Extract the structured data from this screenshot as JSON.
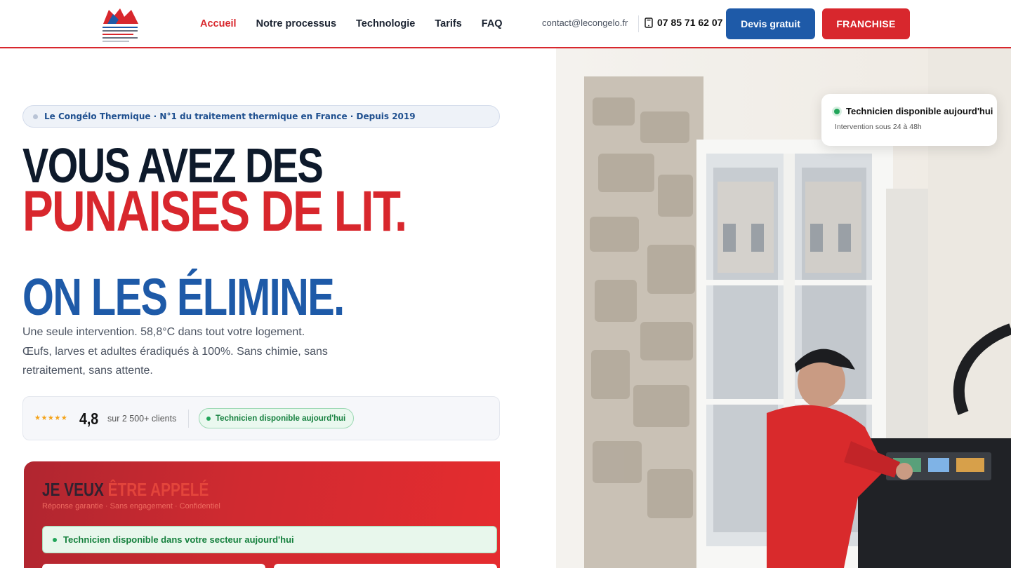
{
  "header": {
    "logo_icon": "le-congelo-logo",
    "nav": [
      {
        "label": "Accueil",
        "active": true
      },
      {
        "label": "Notre processus",
        "active": false
      },
      {
        "label": "Technologie",
        "active": false
      },
      {
        "label": "Tarifs",
        "active": false
      },
      {
        "label": "FAQ",
        "active": false
      }
    ],
    "email": "contact@lecongelo.fr",
    "phone_icon": "phone-icon",
    "phone": "07 85 71 62 07",
    "cta_devis": "Devis gratuit",
    "cta_franchise": "FRANCHISE"
  },
  "hero": {
    "badge": "Le Congélo Thermique · N°1 du traitement thermique en France · Depuis 2019",
    "headline_line1": "VOUS AVEZ DES",
    "headline_line2": "PUNAISES DE LIT.",
    "headline_line3": "ON LES ÉLIMINE.",
    "lead_line1": "Une seule intervention. 58,8°C dans tout votre logement.",
    "lead_line2": "Œufs, larves et adultes éradiqués à 100%. Sans chimie, sans",
    "lead_line3": "retraitement, sans attente.",
    "rating": {
      "stars": "★★★★★",
      "score": "4,8",
      "score_sub": "sur 2 500+ clients",
      "availability": "Technicien disponible aujourd'hui"
    },
    "image_card": {
      "title": "Technicien disponible aujourd'hui",
      "subtitle": "Intervention sous 24 à 48h"
    }
  },
  "form": {
    "title_prefix": "JE VEUX",
    "title_accent": "ÊTRE APPELÉ",
    "subtitle": "Réponse garantie · Sans engagement · Confidentiel",
    "availability": "Technicien disponible dans votre secteur aujourd'hui"
  },
  "colors": {
    "brand_red": "#d8272d",
    "brand_blue": "#1e5aa8",
    "dark": "#0e1a2b",
    "success": "#22a55a"
  }
}
